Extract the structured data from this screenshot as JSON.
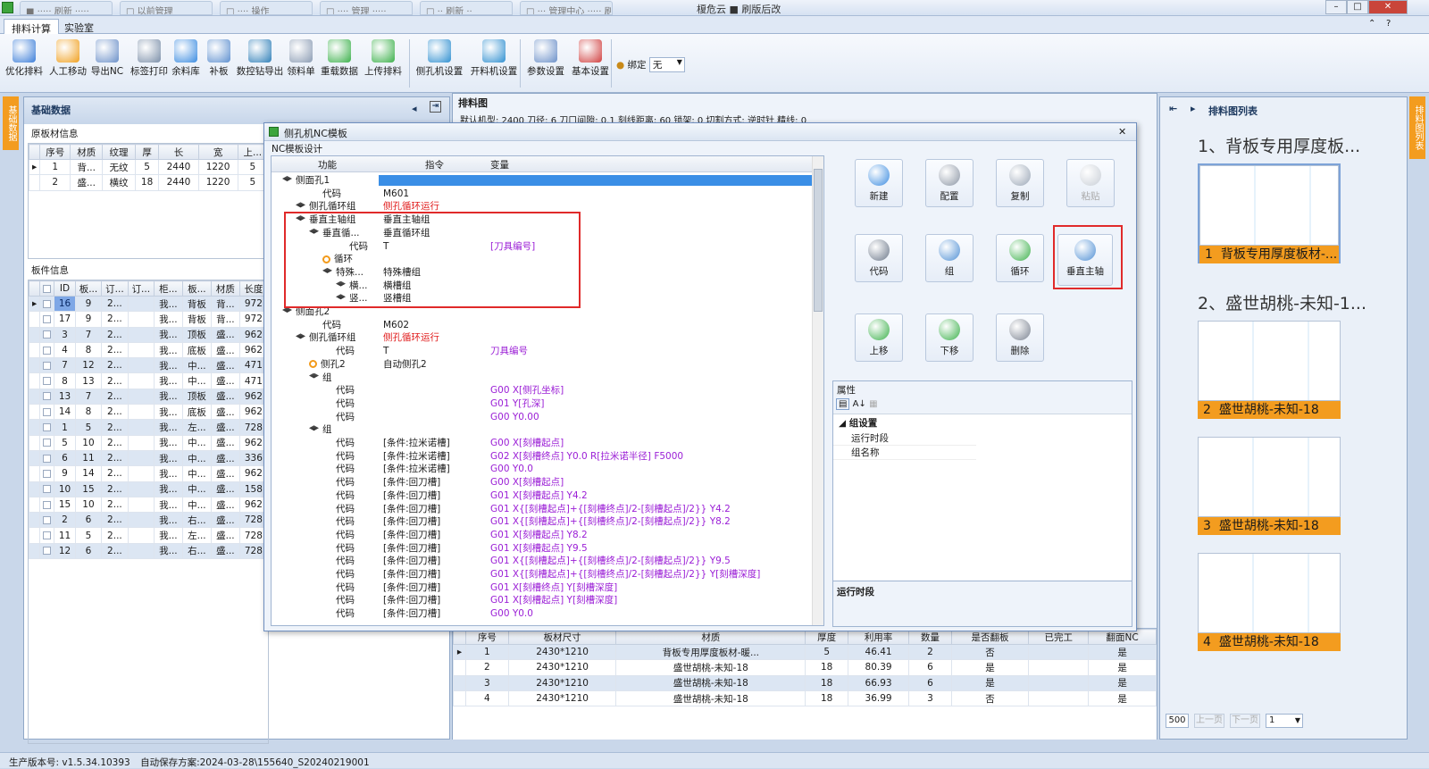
{
  "window": {
    "title": "榎危云 ■ 刷版后改",
    "browser_tabs": [
      "■ ····· 刷新 ·····",
      "□ 以前管理",
      "□ ···· 操作",
      "□ ···· 管理 ·····",
      "□ ·· 刷新 ··",
      "□ ··· 管理中心 ····· 刷新"
    ]
  },
  "ribbon_tabs": [
    "排料计算",
    "实验室"
  ],
  "toolbar": [
    {
      "label": "优化排料",
      "icon": "optimize-icon",
      "color": "#3b7dd8"
    },
    {
      "label": "人工移动",
      "icon": "move-icon",
      "color": "#f0a020"
    },
    {
      "label": "导出NC",
      "icon": "export-nc-icon",
      "color": "#6a8fc8"
    },
    {
      "label": "标签打印",
      "icon": "print-icon",
      "color": "#7a8ea8"
    },
    {
      "label": "余料库",
      "icon": "plus-circle-icon",
      "color": "#3a8be0"
    },
    {
      "label": "补板",
      "icon": "add-board-icon",
      "color": "#5d8fcf"
    },
    {
      "label": "数控钻导出",
      "icon": "drill-icon",
      "color": "#2f7fb8"
    },
    {
      "label": "领料单",
      "icon": "list-icon",
      "color": "#8a9bb3"
    },
    {
      "label": "重载数据",
      "icon": "reload-icon",
      "color": "#3bb04a"
    },
    {
      "label": "上传排料",
      "icon": "upload-icon",
      "color": "#3bb04a"
    },
    {
      "label": "侧孔机设置",
      "icon": "side-drill-icon",
      "color": "#2f8fd0"
    },
    {
      "label": "开料机设置",
      "icon": "cutter-icon",
      "color": "#2f8fd0"
    },
    {
      "label": "参数设置",
      "icon": "params-icon",
      "color": "#6a8fc8"
    },
    {
      "label": "基本设置",
      "icon": "tools-icon",
      "color": "#d04040"
    }
  ],
  "bind": {
    "label": "绑定",
    "value": "无"
  },
  "left_strip": "基础数据",
  "right_strip": "排料图列表",
  "basic_panel": {
    "title": "基础数据",
    "board_section": "原板材信息",
    "board_headers": [
      "序号",
      "材质",
      "纹理",
      "厚",
      "长",
      "宽",
      "上..."
    ],
    "board_rows": [
      [
        "1",
        "背...",
        "无纹",
        "5",
        "2440",
        "1220",
        "5"
      ],
      [
        "2",
        "盛...",
        "横纹",
        "18",
        "2440",
        "1220",
        "5"
      ]
    ],
    "part_section": "板件信息",
    "part_headers": [
      "ID",
      "板...",
      "订...",
      "订...",
      "柜...",
      "板...",
      "材质",
      "长度"
    ],
    "part_rows": [
      [
        "16",
        "9",
        "2...",
        "",
        "我...",
        "背板",
        "背...",
        "972"
      ],
      [
        "17",
        "9",
        "2...",
        "",
        "我...",
        "背板",
        "背...",
        "972"
      ],
      [
        "3",
        "7",
        "2...",
        "",
        "我...",
        "顶板",
        "盛...",
        "962"
      ],
      [
        "4",
        "8",
        "2...",
        "",
        "我...",
        "底板",
        "盛...",
        "962"
      ],
      [
        "7",
        "12",
        "2...",
        "",
        "我...",
        "中...",
        "盛...",
        "471"
      ],
      [
        "8",
        "13",
        "2...",
        "",
        "我...",
        "中...",
        "盛...",
        "471"
      ],
      [
        "13",
        "7",
        "2...",
        "",
        "我...",
        "顶板",
        "盛...",
        "962"
      ],
      [
        "14",
        "8",
        "2...",
        "",
        "我...",
        "底板",
        "盛...",
        "962"
      ],
      [
        "1",
        "5",
        "2...",
        "",
        "我...",
        "左...",
        "盛...",
        "728"
      ],
      [
        "5",
        "10",
        "2...",
        "",
        "我...",
        "中...",
        "盛...",
        "962"
      ],
      [
        "6",
        "11",
        "2...",
        "",
        "我...",
        "中...",
        "盛...",
        "336"
      ],
      [
        "9",
        "14",
        "2...",
        "",
        "我...",
        "中...",
        "盛...",
        "962"
      ],
      [
        "10",
        "15",
        "2...",
        "",
        "我...",
        "中...",
        "盛...",
        "158"
      ],
      [
        "15",
        "10",
        "2...",
        "",
        "我...",
        "中...",
        "盛...",
        "962"
      ],
      [
        "2",
        "6",
        "2...",
        "",
        "我...",
        "右...",
        "盛...",
        "728"
      ],
      [
        "11",
        "5",
        "2...",
        "",
        "我...",
        "左...",
        "盛...",
        "728"
      ],
      [
        "12",
        "6",
        "2...",
        "",
        "我...",
        "右...",
        "盛...",
        "728"
      ]
    ]
  },
  "layout_panel": {
    "title": "排料图",
    "params": "默认机型:  2400    刀径:  6    刀口间隙:  0.1    刻线距离:  60    锁架:  0    切割方式:  逆时针    精线:  0"
  },
  "bottom_table": {
    "headers": [
      "序号",
      "板材尺寸",
      "材质",
      "厚度",
      "利用率",
      "数量",
      "是否翻板",
      "已完工",
      "翻面NC"
    ],
    "rows": [
      [
        "1",
        "2430*1210",
        "背板专用厚度板材-暖...",
        "5",
        "46.41",
        "2",
        "否",
        "",
        "是"
      ],
      [
        "2",
        "2430*1210",
        "盛世胡桃-未知-18",
        "18",
        "80.39",
        "6",
        "是",
        "",
        "是"
      ],
      [
        "3",
        "2430*1210",
        "盛世胡桃-未知-18",
        "18",
        "66.93",
        "6",
        "是",
        "",
        "是"
      ],
      [
        "4",
        "2430*1210",
        "盛世胡桃-未知-18",
        "18",
        "36.99",
        "3",
        "否",
        "",
        "是"
      ]
    ]
  },
  "dialog": {
    "title": "侧孔机NC模板",
    "group_label": "NC模板设计",
    "tree_headers": [
      "功能",
      "指令",
      "变量"
    ],
    "tree_rows": [
      {
        "f": "侧面孔1",
        "c": "",
        "v": "",
        "lvl": 0,
        "icon": "stack",
        "sel": true
      },
      {
        "f": "代码",
        "c": "M601",
        "v": "",
        "lvl": 2
      },
      {
        "f": "侧孔循环组",
        "c": "侧孔循环运行",
        "v": "",
        "lvl": 1,
        "icon": "stack",
        "cc": "red"
      },
      {
        "f": "垂直主轴组",
        "c": "垂直主轴组",
        "v": "",
        "lvl": 1,
        "icon": "stack"
      },
      {
        "f": "垂直循...",
        "c": "垂直循环组",
        "v": "",
        "lvl": 2,
        "icon": "stack"
      },
      {
        "f": "代码",
        "c": "T",
        "v": "[刀具编号]",
        "lvl": 4
      },
      {
        "f": "循环",
        "c": "",
        "v": "",
        "lvl": 3,
        "icon": "loop"
      },
      {
        "f": "特殊...",
        "c": "特殊槽组",
        "v": "",
        "lvl": 3,
        "icon": "stack"
      },
      {
        "f": "横...",
        "c": "横槽组",
        "v": "",
        "lvl": 4,
        "icon": "stack"
      },
      {
        "f": "竖...",
        "c": "竖槽组",
        "v": "",
        "lvl": 4,
        "icon": "stack"
      },
      {
        "f": "侧面孔2",
        "c": "",
        "v": "",
        "lvl": 0,
        "icon": "stack"
      },
      {
        "f": "代码",
        "c": "M602",
        "v": "",
        "lvl": 2
      },
      {
        "f": "侧孔循环组",
        "c": "侧孔循环运行",
        "v": "",
        "lvl": 1,
        "icon": "stack",
        "cc": "red"
      },
      {
        "f": "代码",
        "c": "T",
        "v": "刀具编号",
        "lvl": 3
      },
      {
        "f": "侧孔2",
        "c": "自动侧孔2",
        "v": "",
        "lvl": 2,
        "icon": "loop"
      },
      {
        "f": "组",
        "c": "",
        "v": "",
        "lvl": 2,
        "icon": "stack"
      },
      {
        "f": "代码",
        "c": "",
        "v": "G00 X[侧孔坐标]",
        "lvl": 3
      },
      {
        "f": "代码",
        "c": "",
        "v": "G01 Y[孔深]",
        "lvl": 3
      },
      {
        "f": "代码",
        "c": "",
        "v": "G00 Y0.00",
        "lvl": 3
      },
      {
        "f": "组",
        "c": "",
        "v": "",
        "lvl": 2,
        "icon": "stack"
      },
      {
        "f": "代码",
        "c": "[条件:拉米诺槽]",
        "v": "G00 X[刻槽起点]",
        "lvl": 3
      },
      {
        "f": "代码",
        "c": "[条件:拉米诺槽]",
        "v": "G02 X[刻槽终点] Y0.0 R[拉米诺半径] F5000",
        "lvl": 3
      },
      {
        "f": "代码",
        "c": "[条件:拉米诺槽]",
        "v": "G00 Y0.0",
        "lvl": 3
      },
      {
        "f": "代码",
        "c": "[条件:回刀槽]",
        "v": "G00 X[刻槽起点]",
        "lvl": 3
      },
      {
        "f": "代码",
        "c": "[条件:回刀槽]",
        "v": "G01 X[刻槽起点] Y4.2",
        "lvl": 3
      },
      {
        "f": "代码",
        "c": "[条件:回刀槽]",
        "v": "G01 X{[刻槽起点]+{[刻槽终点]/2-[刻槽起点]/2}} Y4.2",
        "lvl": 3
      },
      {
        "f": "代码",
        "c": "[条件:回刀槽]",
        "v": "G01 X{[刻槽起点]+{[刻槽终点]/2-[刻槽起点]/2}} Y8.2",
        "lvl": 3
      },
      {
        "f": "代码",
        "c": "[条件:回刀槽]",
        "v": "G01 X[刻槽起点] Y8.2",
        "lvl": 3
      },
      {
        "f": "代码",
        "c": "[条件:回刀槽]",
        "v": "G01 X[刻槽起点] Y9.5",
        "lvl": 3
      },
      {
        "f": "代码",
        "c": "[条件:回刀槽]",
        "v": "G01 X{[刻槽起点]+{[刻槽终点]/2-[刻槽起点]/2}} Y9.5",
        "lvl": 3
      },
      {
        "f": "代码",
        "c": "[条件:回刀槽]",
        "v": "G01 X{[刻槽起点]+{[刻槽终点]/2-[刻槽起点]/2}} Y[刻槽深度]",
        "lvl": 3
      },
      {
        "f": "代码",
        "c": "[条件:回刀槽]",
        "v": "G01 X[刻槽终点] Y[刻槽深度]",
        "lvl": 3
      },
      {
        "f": "代码",
        "c": "[条件:回刀槽]",
        "v": "G01 X[刻槽起点] Y[刻槽深度]",
        "lvl": 3
      },
      {
        "f": "代码",
        "c": "[条件:回刀槽]",
        "v": "G00 Y0.0",
        "lvl": 3
      }
    ],
    "buttons": [
      {
        "label": "新建",
        "icon": "new-icon",
        "enabled": true
      },
      {
        "label": "配置",
        "icon": "config-gear-icon",
        "enabled": true
      },
      {
        "label": "复制",
        "icon": "copy-icon",
        "enabled": true
      },
      {
        "label": "粘贴",
        "icon": "paste-icon",
        "enabled": false
      },
      {
        "label": "代码",
        "icon": "code-book-icon",
        "enabled": true
      },
      {
        "label": "组",
        "icon": "group-icon",
        "enabled": true
      },
      {
        "label": "循环",
        "icon": "loop-icon",
        "enabled": true
      },
      {
        "label": "垂直主轴",
        "icon": "vertical-spindle-icon",
        "enabled": true
      },
      {
        "label": "上移",
        "icon": "move-up-icon",
        "enabled": true
      },
      {
        "label": "下移",
        "icon": "move-down-icon",
        "enabled": true
      },
      {
        "label": "删除",
        "icon": "trash-icon",
        "enabled": true
      }
    ],
    "props": {
      "title": "属性",
      "category": "组设置",
      "rows": [
        "运行时段",
        "组名称"
      ],
      "desc": "运行时段"
    }
  },
  "list_panel": {
    "title": "排料图列表",
    "groups": [
      {
        "heading": "1、背板专用厚度板...",
        "items": [
          {
            "no": "1",
            "label": "背板专用厚度板材-..."
          }
        ]
      },
      {
        "heading": "2、盛世胡桃-未知-1...",
        "items": [
          {
            "no": "2",
            "label": "盛世胡桃-未知-18"
          },
          {
            "no": "3",
            "label": "盛世胡桃-未知-18"
          },
          {
            "no": "4",
            "label": "盛世胡桃-未知-18"
          }
        ]
      }
    ],
    "pager": {
      "size": "500",
      "prev": "上一页",
      "next": "下一页",
      "page": "1"
    }
  },
  "status": {
    "version": "生产版本号:  v1.5.34.10393",
    "autosave": "自动保存方案:2024-03-28\\155640_S20240219001"
  }
}
